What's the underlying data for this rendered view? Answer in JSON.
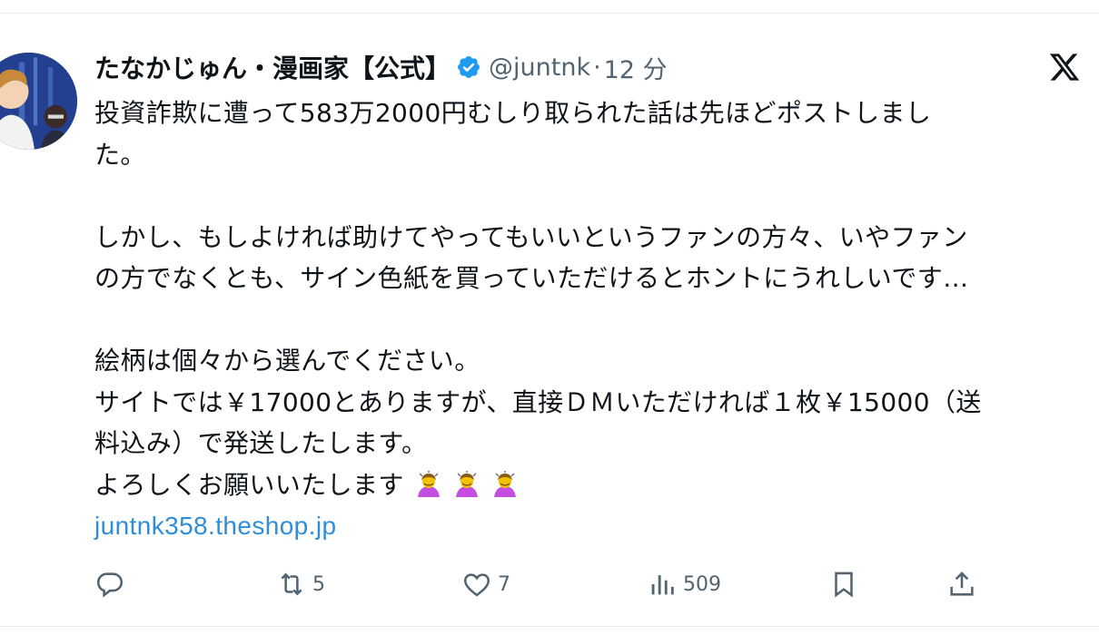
{
  "tweet": {
    "display_name": "たなかじゅん・漫画家【公式】",
    "handle": "@juntnk",
    "separator": "·",
    "timestamp": "12 分",
    "lines": [
      "投資詐欺に遭って583万2000円むしり取られた話は先ほどポストしまし",
      "た。",
      "",
      "しかし、もしよければ助けてやってもいいというファンの方々、いやファン",
      "の方でなくとも、サイン色紙を買っていただけるとホントにうれしいです…",
      "",
      "絵柄は個々から選んでください。",
      "サイトでは￥17000とありますが、直接ＤＭいただければ１枚￥15000（送",
      "料込み）で発送したします。",
      "よろしくお願いいたします"
    ],
    "emoji": [
      "woman-bowing-emoji",
      "woman-bowing-emoji",
      "woman-bowing-emoji"
    ],
    "link_text": "juntnk358.theshop.jp"
  },
  "actions": {
    "reply_count": "",
    "retweet_count": "5",
    "like_count": "7",
    "views_count": "509"
  },
  "icons": {
    "verified": "verified-badge-icon",
    "logo": "x-logo-icon",
    "reply": "reply-icon",
    "retweet": "retweet-icon",
    "like": "heart-icon",
    "views": "views-icon",
    "bookmark": "bookmark-icon",
    "share": "share-icon"
  },
  "colors": {
    "text": "#0f1419",
    "secondary": "#536471",
    "link": "#2f8ed6",
    "verified": "#1d9bf0"
  }
}
